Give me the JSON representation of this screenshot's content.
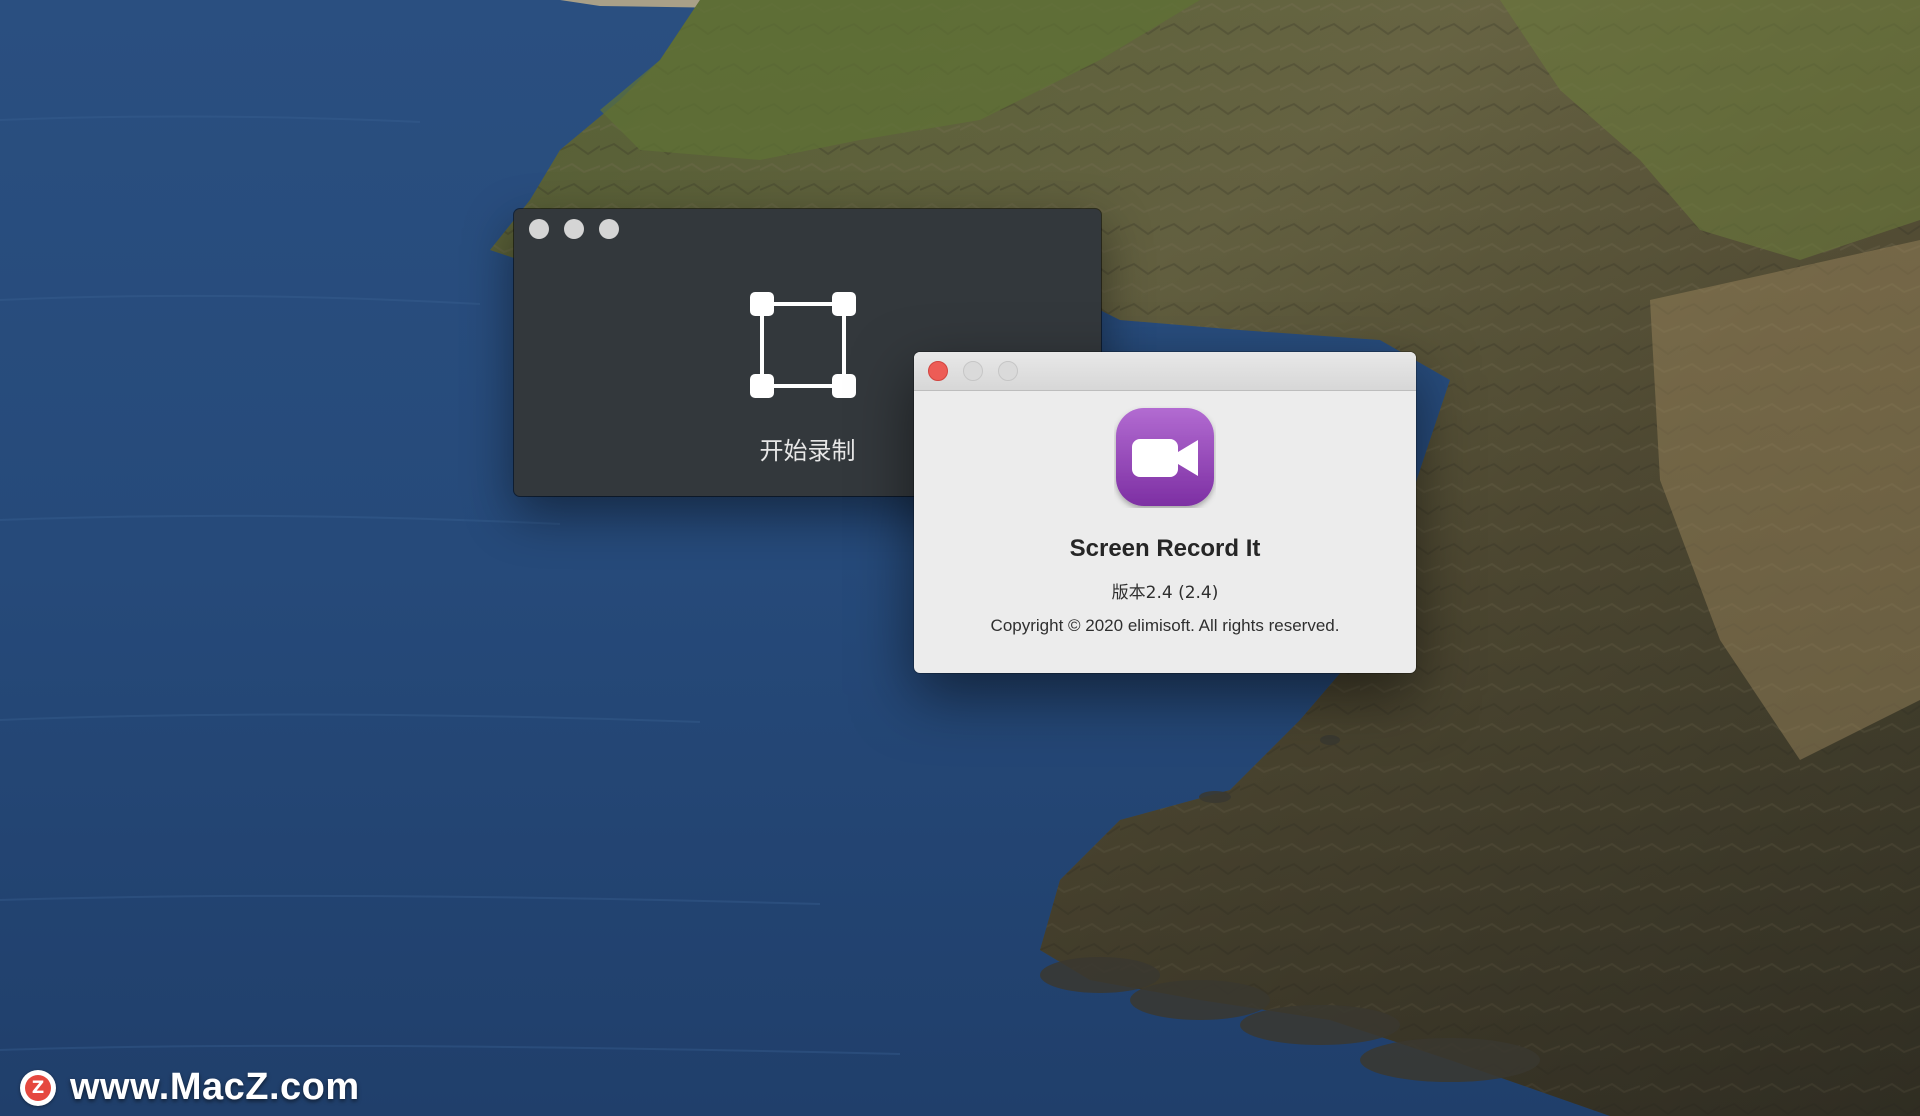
{
  "recorder": {
    "start_label": "开始录制",
    "frame_icon": "record-area-icon",
    "window_color": "#33383c"
  },
  "about": {
    "app_name": "Screen Record It",
    "version": "版本2.4 (2.4)",
    "copyright": "Copyright © 2020 elimisoft. All rights reserved.",
    "app_icon": "video-camera-icon",
    "icon_colors": [
      "#b26bd1",
      "#7d2fa3"
    ]
  },
  "watermark": {
    "text": "www.MacZ.com",
    "logo_letter": "Z",
    "logo_color": "#e5483f"
  },
  "wallpaper": {
    "name": "macOS Catalina coastline",
    "sea_color": "#264a7a",
    "cliff_color": "#5b5a3c"
  }
}
